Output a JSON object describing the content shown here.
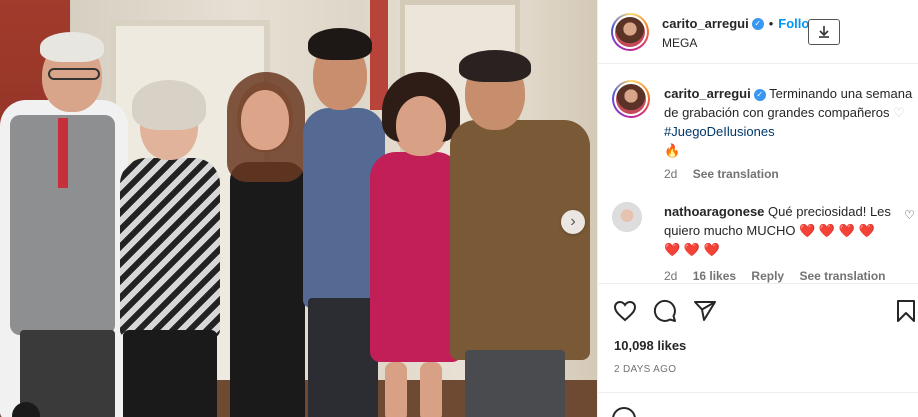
{
  "post": {
    "username": "carito_arregui",
    "follow_label": "Follo",
    "location": "MEGA",
    "caption": {
      "username": "carito_arregui",
      "text": "Terminando una semana de grabación con grandes compañeros",
      "hashtag": "#JuegoDeIlusiones",
      "age": "2d",
      "see_translation": "See translation"
    },
    "comments": [
      {
        "username": "nathoaragonese",
        "text": "Qué preciosidad! Les quiero mucho MUCHO",
        "age": "2d",
        "likes": "16 likes",
        "reply": "Reply",
        "see_translation": "See translation"
      }
    ],
    "likes": "10,098 likes",
    "date": "2 DAYS AGO"
  },
  "icons": {
    "verified": "verified-badge",
    "download": "download-icon",
    "like": "heart-icon",
    "comment": "comment-icon",
    "share": "share-icon",
    "save": "bookmark-icon",
    "next": "chevron-right-icon"
  },
  "colors": {
    "accent": "#0095f6",
    "verified": "#3897f0",
    "heart": "#ed4956",
    "hashtag": "#00376b",
    "muted": "#737373"
  }
}
